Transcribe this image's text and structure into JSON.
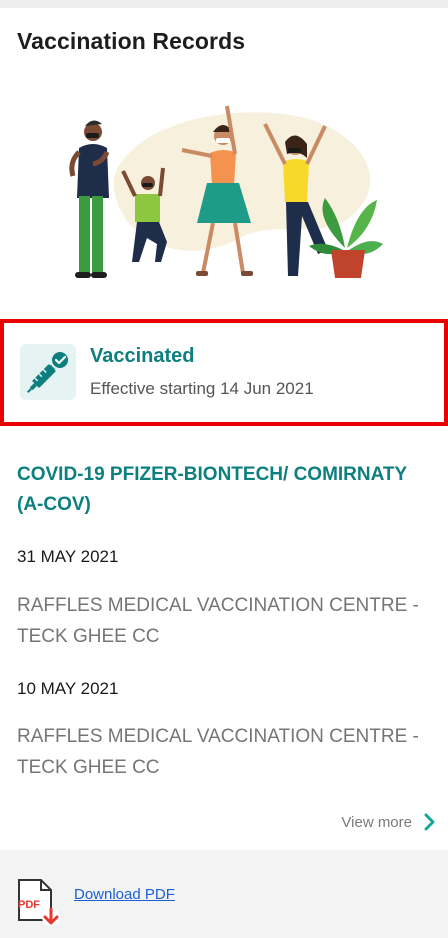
{
  "header": {
    "title": "Vaccination Records"
  },
  "illustration": {
    "icon": "family-celebration-illustration"
  },
  "status": {
    "title": "Vaccinated",
    "subtitle": "Effective starting 14 Jun 2021",
    "icon": "vaccine-check-icon",
    "highlight_color": "#ea0000",
    "accent_color": "#0d7f7f"
  },
  "vaccine": {
    "name": "COVID-19 PFIZER-BIONTECH/ COMIRNATY (A-COV)",
    "doses": [
      {
        "date": "31 MAY 2021",
        "location": "RAFFLES MEDICAL VACCINATION CENTRE - TECK GHEE CC"
      },
      {
        "date": "10 MAY 2021",
        "location": "RAFFLES MEDICAL VACCINATION CENTRE - TECK GHEE CC"
      }
    ]
  },
  "view_more": {
    "label": "View more",
    "icon": "chevron-right-icon"
  },
  "footer": {
    "download_label": "Download PDF",
    "icon": "pdf-download-icon",
    "icon_text": "PDF"
  }
}
